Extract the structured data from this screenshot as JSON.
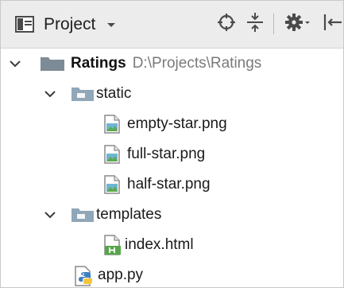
{
  "toolbar": {
    "view_label": "Project",
    "icons": [
      "project-view-icon",
      "chevron-down-icon",
      "locate-target-icon",
      "collapse-all-icon",
      "gear-icon",
      "hide-panel-icon"
    ]
  },
  "tree": {
    "root": {
      "name": "Ratings",
      "path": "D:\\Projects\\Ratings"
    },
    "static_folder": "static",
    "static_files": [
      "empty-star.png",
      "full-star.png",
      "half-star.png"
    ],
    "templates_folder": "templates",
    "templates_files": [
      "index.html"
    ],
    "root_files": [
      "app.py"
    ]
  },
  "colors": {
    "toolbar_bg": "#ececec",
    "folder": "#8fa7b8",
    "root_folder": "#7d8b96",
    "arrow": "#3c3c3c"
  }
}
